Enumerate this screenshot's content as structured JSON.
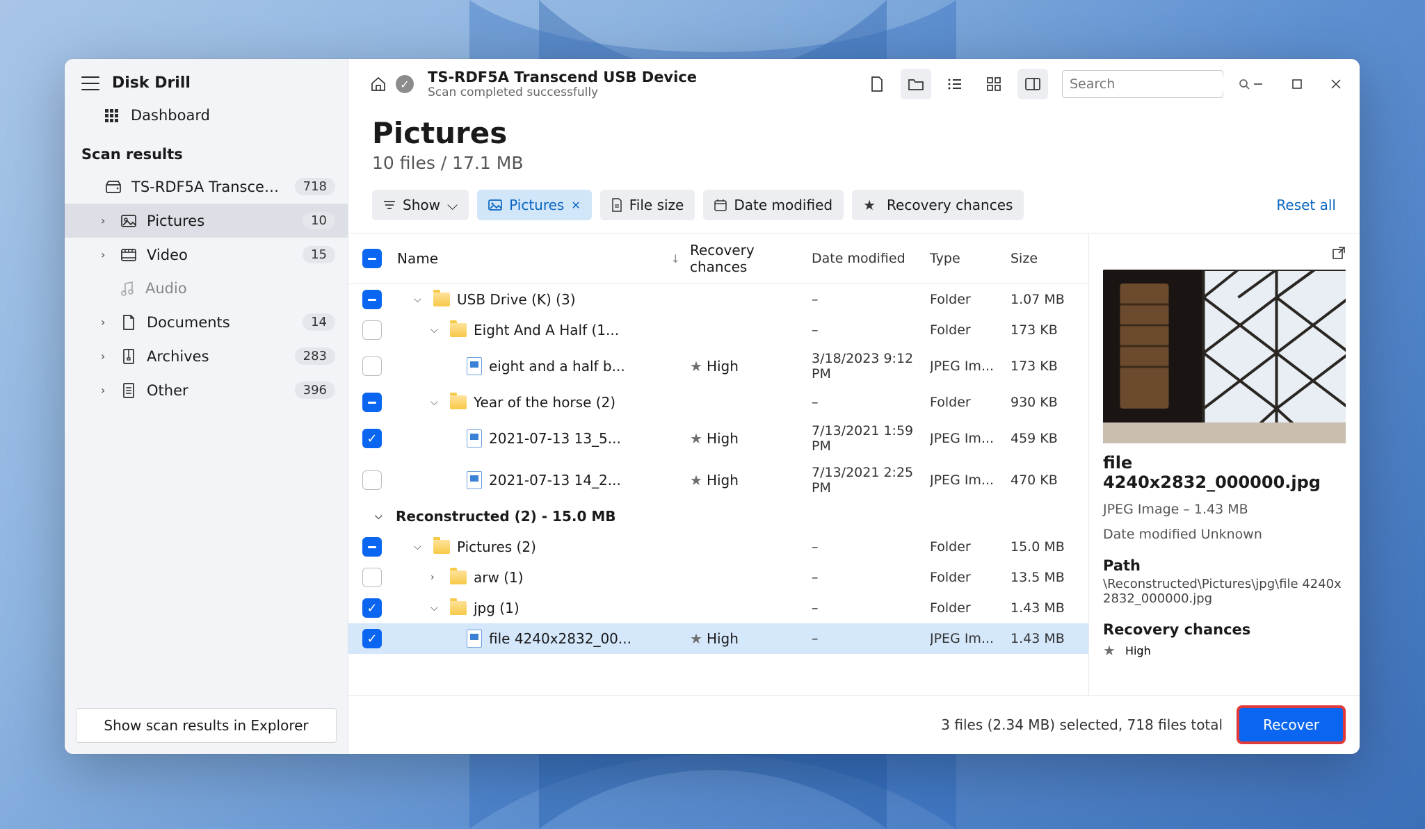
{
  "app_title": "Disk Drill",
  "dashboard_label": "Dashboard",
  "scan_results_label": "Scan results",
  "nav": [
    {
      "id": "device",
      "label": "TS-RDF5A Transcend US...",
      "badge": "718"
    },
    {
      "id": "pictures",
      "label": "Pictures",
      "badge": "10"
    },
    {
      "id": "video",
      "label": "Video",
      "badge": "15"
    },
    {
      "id": "audio",
      "label": "Audio"
    },
    {
      "id": "documents",
      "label": "Documents",
      "badge": "14"
    },
    {
      "id": "archives",
      "label": "Archives",
      "badge": "283"
    },
    {
      "id": "other",
      "label": "Other",
      "badge": "396"
    }
  ],
  "explorer_btn": "Show scan results in Explorer",
  "topbar": {
    "device": "TS-RDF5A Transcend USB Device",
    "status": "Scan completed successfully",
    "search_placeholder": "Search"
  },
  "header": {
    "title": "Pictures",
    "sub": "10 files / 17.1 MB"
  },
  "filters": {
    "show": "Show",
    "pictures": "Pictures",
    "filesize": "File size",
    "datemod": "Date modified",
    "recovery": "Recovery chances",
    "reset": "Reset all"
  },
  "table": {
    "headers": {
      "name": "Name",
      "recovery": "Recovery chances",
      "date": "Date modified",
      "type": "Type",
      "size": "Size"
    },
    "rows": [
      {
        "check": "partial",
        "indent": 1,
        "toggle": "down",
        "icon": "folder",
        "name": "USB Drive (K) (3)",
        "rec": "",
        "date": "–",
        "type": "Folder",
        "size": "1.07 MB"
      },
      {
        "check": "empty",
        "indent": 2,
        "toggle": "down",
        "icon": "folder",
        "name": "Eight And A Half (1...",
        "rec": "",
        "date": "–",
        "type": "Folder",
        "size": "173 KB"
      },
      {
        "check": "empty",
        "indent": 3,
        "toggle": "",
        "icon": "file",
        "name": "eight and a half b...",
        "rec": "High",
        "date": "3/18/2023 9:12 PM",
        "type": "JPEG Im...",
        "size": "173 KB"
      },
      {
        "check": "partial",
        "indent": 2,
        "toggle": "down",
        "icon": "folder",
        "name": "Year of the horse (2)",
        "rec": "",
        "date": "–",
        "type": "Folder",
        "size": "930 KB"
      },
      {
        "check": "checked",
        "indent": 3,
        "toggle": "",
        "icon": "file",
        "name": "2021-07-13 13_5...",
        "rec": "High",
        "date": "7/13/2021 1:59 PM",
        "type": "JPEG Im...",
        "size": "459 KB"
      },
      {
        "check": "empty",
        "indent": 3,
        "toggle": "",
        "icon": "file",
        "name": "2021-07-13 14_2...",
        "rec": "High",
        "date": "7/13/2021 2:25 PM",
        "type": "JPEG Im...",
        "size": "470 KB"
      }
    ],
    "group": "Reconstructed (2) - 15.0 MB",
    "rows2": [
      {
        "check": "partial",
        "indent": 1,
        "toggle": "down",
        "icon": "folder",
        "name": "Pictures (2)",
        "rec": "",
        "date": "–",
        "type": "Folder",
        "size": "15.0 MB"
      },
      {
        "check": "empty",
        "indent": 2,
        "toggle": "right",
        "icon": "folder",
        "name": "arw (1)",
        "rec": "",
        "date": "–",
        "type": "Folder",
        "size": "13.5 MB"
      },
      {
        "check": "checked",
        "indent": 2,
        "toggle": "down",
        "icon": "folder",
        "name": "jpg (1)",
        "rec": "",
        "date": "–",
        "type": "Folder",
        "size": "1.43 MB"
      },
      {
        "check": "checked",
        "indent": 3,
        "toggle": "",
        "icon": "file",
        "name": "file 4240x2832_00...",
        "rec": "High",
        "date": "–",
        "type": "JPEG Im...",
        "size": "1.43 MB",
        "selected": true
      }
    ]
  },
  "preview": {
    "title": "file 4240x2832_000000.jpg",
    "meta": "JPEG Image – 1.43 MB",
    "date": "Date modified Unknown",
    "path_label": "Path",
    "path": "\\Reconstructed\\Pictures\\jpg\\file 4240x2832_000000.jpg",
    "rec_label": "Recovery chances",
    "rec_value": "High"
  },
  "footer": {
    "status": "3 files (2.34 MB) selected, 718 files total",
    "recover": "Recover"
  }
}
